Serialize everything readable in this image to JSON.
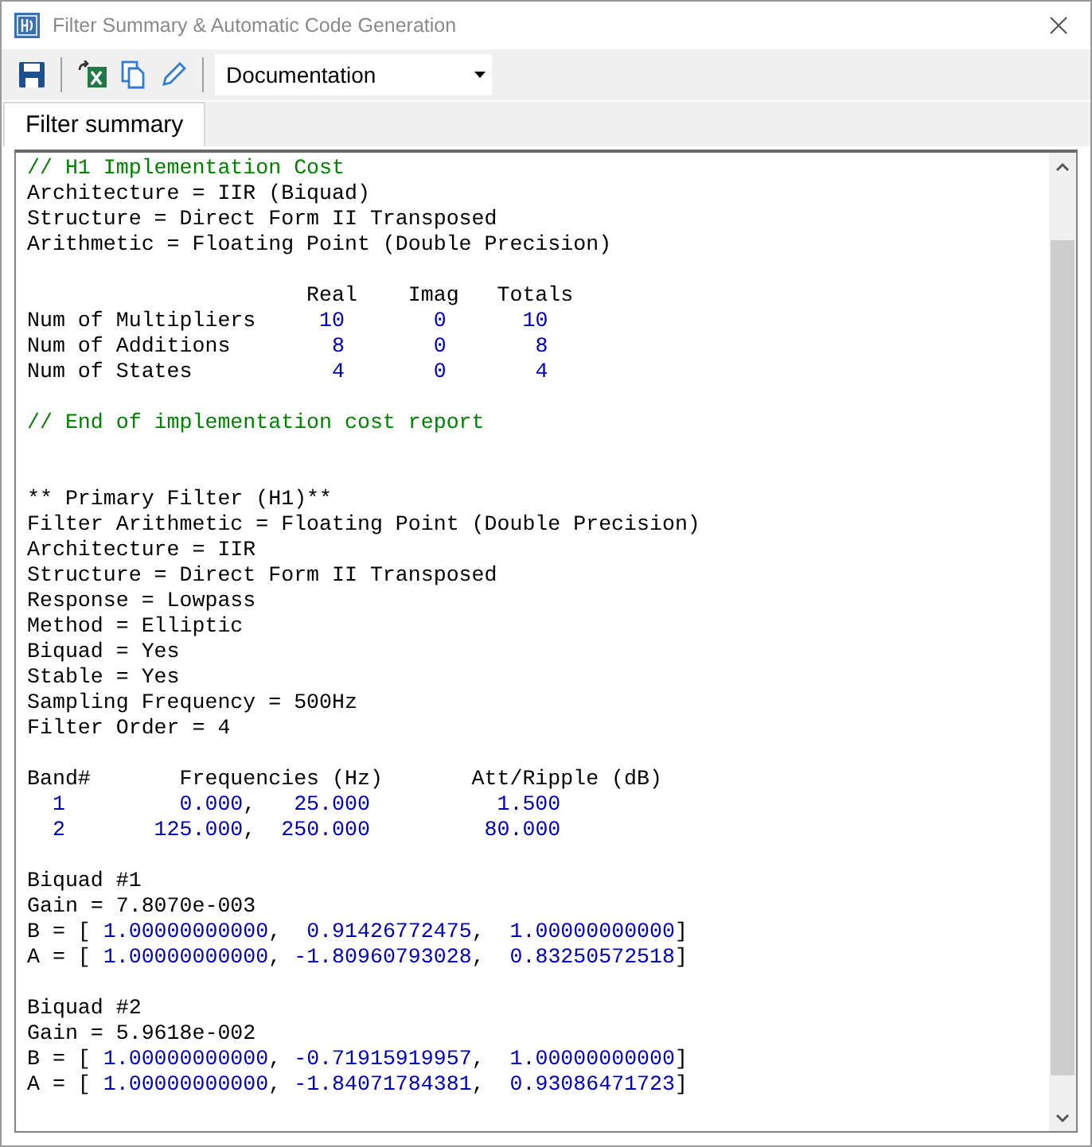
{
  "window": {
    "title": "Filter Summary & Automatic Code Generation"
  },
  "toolbar": {
    "view_select": {
      "value": "Documentation"
    }
  },
  "tabs": [
    {
      "label": "Filter summary",
      "selected": true
    }
  ],
  "report": {
    "lines": [
      {
        "kind": "text",
        "parts": [
          {
            "kind": "comment",
            "t": "// H1 Implementation Cost"
          }
        ]
      },
      {
        "kind": "text",
        "parts": [
          {
            "kind": "plain",
            "t": "Architecture = IIR (Biquad)"
          }
        ]
      },
      {
        "kind": "text",
        "parts": [
          {
            "kind": "plain",
            "t": "Structure = Direct Form II Transposed"
          }
        ]
      },
      {
        "kind": "text",
        "parts": [
          {
            "kind": "plain",
            "t": "Arithmetic = Floating Point (Double Precision)"
          }
        ]
      },
      {
        "kind": "blank"
      },
      {
        "kind": "text",
        "parts": [
          {
            "kind": "plain",
            "t": "                      Real    Imag   Totals"
          }
        ]
      },
      {
        "kind": "text",
        "parts": [
          {
            "kind": "plain",
            "t": "Num of Multipliers     "
          },
          {
            "kind": "number",
            "t": "10       "
          },
          {
            "kind": "number",
            "t": "0      "
          },
          {
            "kind": "number",
            "t": "10"
          }
        ]
      },
      {
        "kind": "text",
        "parts": [
          {
            "kind": "plain",
            "t": "Num of Additions        "
          },
          {
            "kind": "number",
            "t": "8       "
          },
          {
            "kind": "number",
            "t": "0       "
          },
          {
            "kind": "number",
            "t": "8"
          }
        ]
      },
      {
        "kind": "text",
        "parts": [
          {
            "kind": "plain",
            "t": "Num of States           "
          },
          {
            "kind": "number",
            "t": "4       "
          },
          {
            "kind": "number",
            "t": "0       "
          },
          {
            "kind": "number",
            "t": "4"
          }
        ]
      },
      {
        "kind": "blank"
      },
      {
        "kind": "text",
        "parts": [
          {
            "kind": "comment",
            "t": "// End of implementation cost report"
          }
        ]
      },
      {
        "kind": "blank"
      },
      {
        "kind": "blank"
      },
      {
        "kind": "text",
        "parts": [
          {
            "kind": "plain",
            "t": "** Primary Filter (H1)**"
          }
        ]
      },
      {
        "kind": "text",
        "parts": [
          {
            "kind": "plain",
            "t": "Filter Arithmetic = Floating Point (Double Precision)"
          }
        ]
      },
      {
        "kind": "text",
        "parts": [
          {
            "kind": "plain",
            "t": "Architecture = IIR"
          }
        ]
      },
      {
        "kind": "text",
        "parts": [
          {
            "kind": "plain",
            "t": "Structure = Direct Form II Transposed"
          }
        ]
      },
      {
        "kind": "text",
        "parts": [
          {
            "kind": "plain",
            "t": "Response = Lowpass"
          }
        ]
      },
      {
        "kind": "text",
        "parts": [
          {
            "kind": "plain",
            "t": "Method = Elliptic"
          }
        ]
      },
      {
        "kind": "text",
        "parts": [
          {
            "kind": "plain",
            "t": "Biquad = Yes"
          }
        ]
      },
      {
        "kind": "text",
        "parts": [
          {
            "kind": "plain",
            "t": "Stable = Yes"
          }
        ]
      },
      {
        "kind": "text",
        "parts": [
          {
            "kind": "plain",
            "t": "Sampling Frequency = 500Hz"
          }
        ]
      },
      {
        "kind": "text",
        "parts": [
          {
            "kind": "plain",
            "t": "Filter Order = 4"
          }
        ]
      },
      {
        "kind": "blank"
      },
      {
        "kind": "text",
        "parts": [
          {
            "kind": "plain",
            "t": "Band#       Frequencies (Hz)       Att/Ripple (dB)"
          }
        ]
      },
      {
        "kind": "text",
        "parts": [
          {
            "kind": "number",
            "t": "  1         0.000"
          },
          {
            "kind": "plain",
            "t": ",   "
          },
          {
            "kind": "number",
            "t": "25.000          1.500"
          }
        ]
      },
      {
        "kind": "text",
        "parts": [
          {
            "kind": "number",
            "t": "  2       125.000"
          },
          {
            "kind": "plain",
            "t": ",  "
          },
          {
            "kind": "number",
            "t": "250.000         80.000"
          }
        ]
      },
      {
        "kind": "blank"
      },
      {
        "kind": "text",
        "parts": [
          {
            "kind": "plain",
            "t": "Biquad #1"
          }
        ]
      },
      {
        "kind": "text",
        "parts": [
          {
            "kind": "plain",
            "t": "Gain = 7.8070e-003"
          }
        ]
      },
      {
        "kind": "text",
        "parts": [
          {
            "kind": "plain",
            "t": "B = [ "
          },
          {
            "kind": "number",
            "t": "1.00000000000"
          },
          {
            "kind": "plain",
            "t": ",  "
          },
          {
            "kind": "number",
            "t": "0.91426772475"
          },
          {
            "kind": "plain",
            "t": ",  "
          },
          {
            "kind": "number",
            "t": "1.00000000000"
          },
          {
            "kind": "plain",
            "t": "]"
          }
        ]
      },
      {
        "kind": "text",
        "parts": [
          {
            "kind": "plain",
            "t": "A = [ "
          },
          {
            "kind": "number",
            "t": "1.00000000000"
          },
          {
            "kind": "plain",
            "t": ", "
          },
          {
            "kind": "number",
            "t": "-1.80960793028"
          },
          {
            "kind": "plain",
            "t": ",  "
          },
          {
            "kind": "number",
            "t": "0.83250572518"
          },
          {
            "kind": "plain",
            "t": "]"
          }
        ]
      },
      {
        "kind": "blank"
      },
      {
        "kind": "text",
        "parts": [
          {
            "kind": "plain",
            "t": "Biquad #2"
          }
        ]
      },
      {
        "kind": "text",
        "parts": [
          {
            "kind": "plain",
            "t": "Gain = 5.9618e-002"
          }
        ]
      },
      {
        "kind": "text",
        "parts": [
          {
            "kind": "plain",
            "t": "B = [ "
          },
          {
            "kind": "number",
            "t": "1.00000000000"
          },
          {
            "kind": "plain",
            "t": ", "
          },
          {
            "kind": "number",
            "t": "-0.71915919957"
          },
          {
            "kind": "plain",
            "t": ",  "
          },
          {
            "kind": "number",
            "t": "1.00000000000"
          },
          {
            "kind": "plain",
            "t": "]"
          }
        ]
      },
      {
        "kind": "text",
        "parts": [
          {
            "kind": "plain",
            "t": "A = [ "
          },
          {
            "kind": "number",
            "t": "1.00000000000"
          },
          {
            "kind": "plain",
            "t": ", "
          },
          {
            "kind": "number",
            "t": "-1.84071784381"
          },
          {
            "kind": "plain",
            "t": ",  "
          },
          {
            "kind": "number",
            "t": "0.93086471723"
          },
          {
            "kind": "plain",
            "t": "]"
          }
        ]
      }
    ]
  }
}
